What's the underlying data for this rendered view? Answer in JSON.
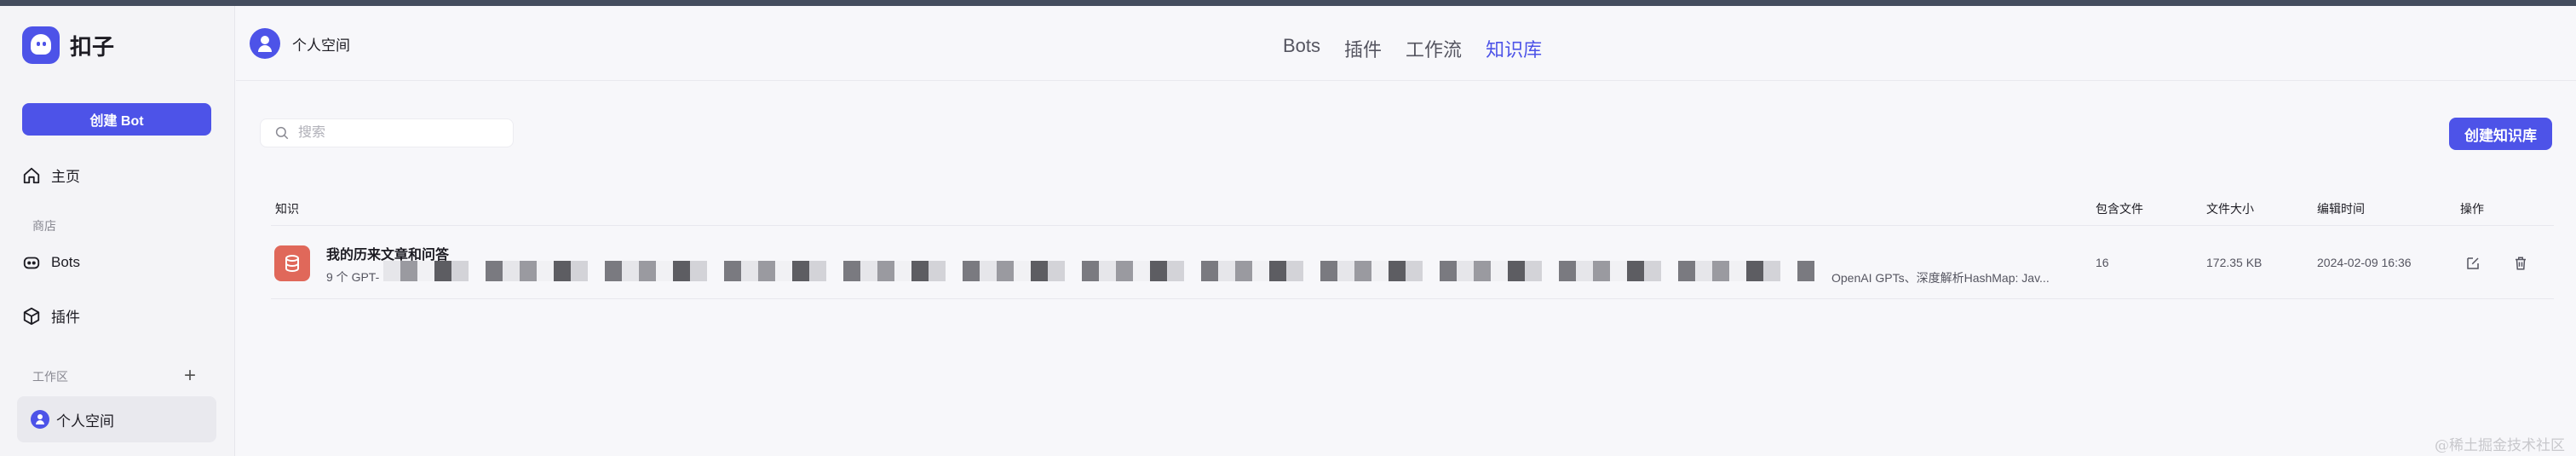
{
  "app": {
    "name": "扣子"
  },
  "sidebar": {
    "create_bot_label": "创建 Bot",
    "home_label": "主页",
    "store_section": "商店",
    "bots_label": "Bots",
    "plugins_label": "插件",
    "workspace_section": "工作区",
    "workspace_item": "个人空间"
  },
  "header": {
    "workspace_title": "个人空间",
    "tabs": [
      {
        "label": "Bots",
        "active": false
      },
      {
        "label": "插件",
        "active": false
      },
      {
        "label": "工作流",
        "active": false
      },
      {
        "label": "知识库",
        "active": true
      }
    ]
  },
  "main": {
    "search_placeholder": "搜索",
    "search_value": "",
    "create_kb_label": "创建知识库",
    "columns": {
      "knowledge": "知识",
      "files": "包含文件",
      "size": "文件大小",
      "edited": "编辑时间",
      "actions": "操作"
    },
    "rows": [
      {
        "title": "我的历来文章和问答",
        "desc_start": "9 个 GPT-",
        "desc_end": "OpenAI GPTs、深度解析HashMap: Jav...",
        "files": "16",
        "size": "172.35 KB",
        "edited": "2024-02-09 16:36",
        "icon": "database-icon"
      }
    ]
  },
  "watermark": "@稀土掘金技术社区",
  "colors": {
    "accent": "#4d53e8",
    "kb_icon_bg": "#e0685a"
  }
}
